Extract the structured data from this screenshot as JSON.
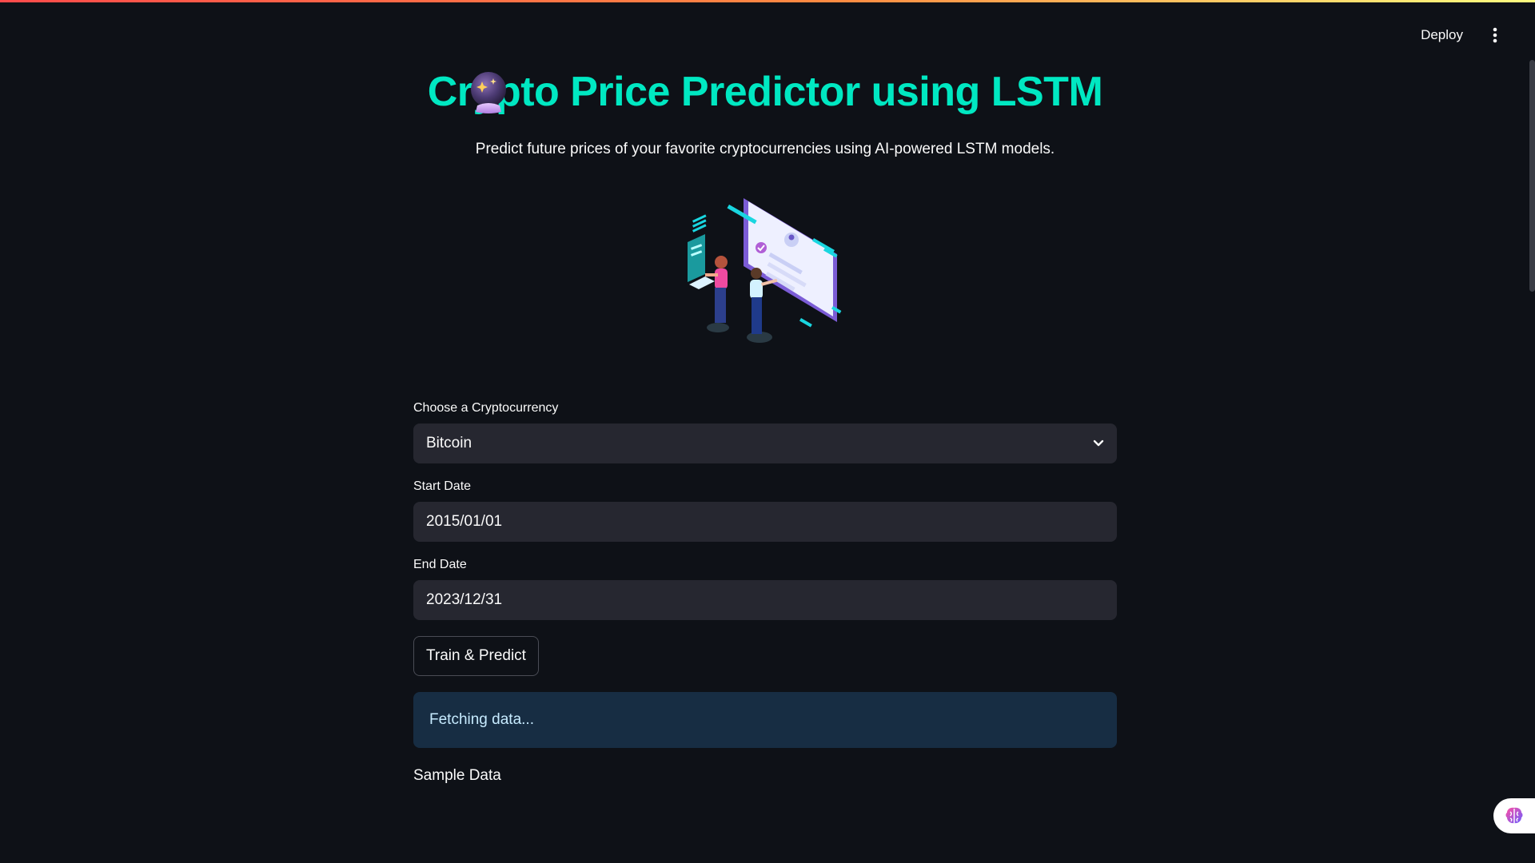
{
  "header": {
    "deploy_label": "Deploy",
    "menu_icon": "vertical-ellipsis-icon"
  },
  "page": {
    "title_icon": "crystal-ball-icon",
    "title": "Crypto Price Predictor using LSTM",
    "subtitle": "Predict future prices of your favorite cryptocurrencies using AI-powered LSTM models.",
    "illustration": "people-dashboard-illustration"
  },
  "form": {
    "crypto": {
      "label": "Choose a Cryptocurrency",
      "selected": "Bitcoin"
    },
    "start_date": {
      "label": "Start Date",
      "value": "2015/01/01"
    },
    "end_date": {
      "label": "End Date",
      "value": "2023/12/31"
    },
    "submit_label": "Train & Predict"
  },
  "status": {
    "message": "Fetching data..."
  },
  "sections": {
    "sample_data": "Sample Data"
  },
  "colors": {
    "background": "#0e1117",
    "title": "#00e8c2",
    "input_bg": "#262730",
    "info_bg": "#172d43",
    "info_text": "#c7ebff"
  }
}
